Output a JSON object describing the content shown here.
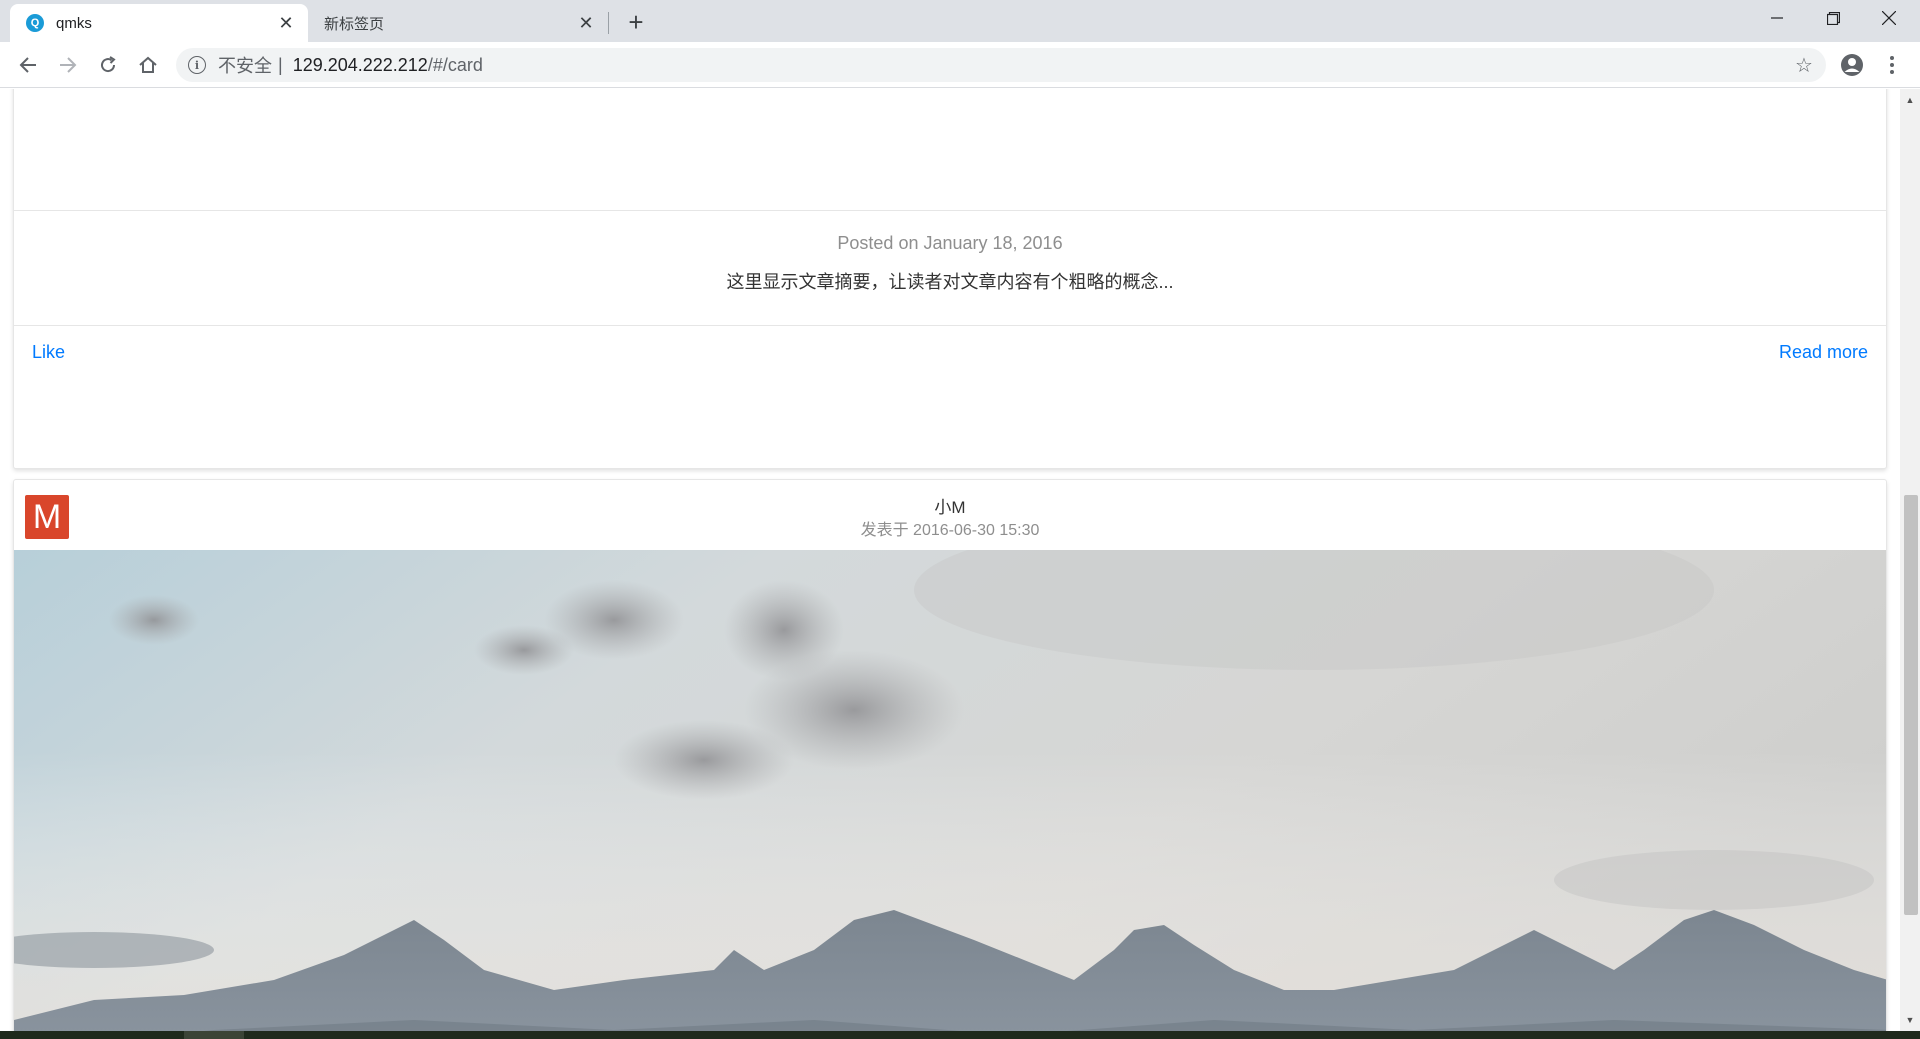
{
  "browser": {
    "tabs": [
      {
        "title": "qmks",
        "active": true,
        "favicon": "qmks-favicon",
        "favicon_glyph": "Q"
      },
      {
        "title": "新标签页",
        "active": false
      }
    ],
    "address_bar": {
      "security_label": "不安全",
      "separator": "|",
      "host": "129.204.222.212",
      "path": "/#/card"
    },
    "icons": {
      "back": "back-arrow-icon",
      "forward": "forward-arrow-icon",
      "reload": "reload-icon",
      "home": "home-icon",
      "star": "star-icon",
      "profile": "profile-icon",
      "menu": "menu-icon",
      "new_tab": "plus-icon",
      "tab_close": "close-icon"
    },
    "glyphs": {
      "close": "✕",
      "plus": "+",
      "star": "☆",
      "info": "i",
      "scroll_up": "▲",
      "scroll_down": "▼"
    }
  },
  "page": {
    "card1": {
      "posted": "Posted on January 18, 2016",
      "summary": "这里显示文章摘要，让读者对文章内容有个粗略的概念...",
      "like_label": "Like",
      "read_more_label": "Read more"
    },
    "card2": {
      "avatar_letter": "M",
      "author": "小M",
      "post_date": "发表于 2016-06-30 15:30"
    }
  },
  "colors": {
    "link": "#007aff",
    "avatar": "#d9462b",
    "tabbar": "#dee1e6"
  }
}
